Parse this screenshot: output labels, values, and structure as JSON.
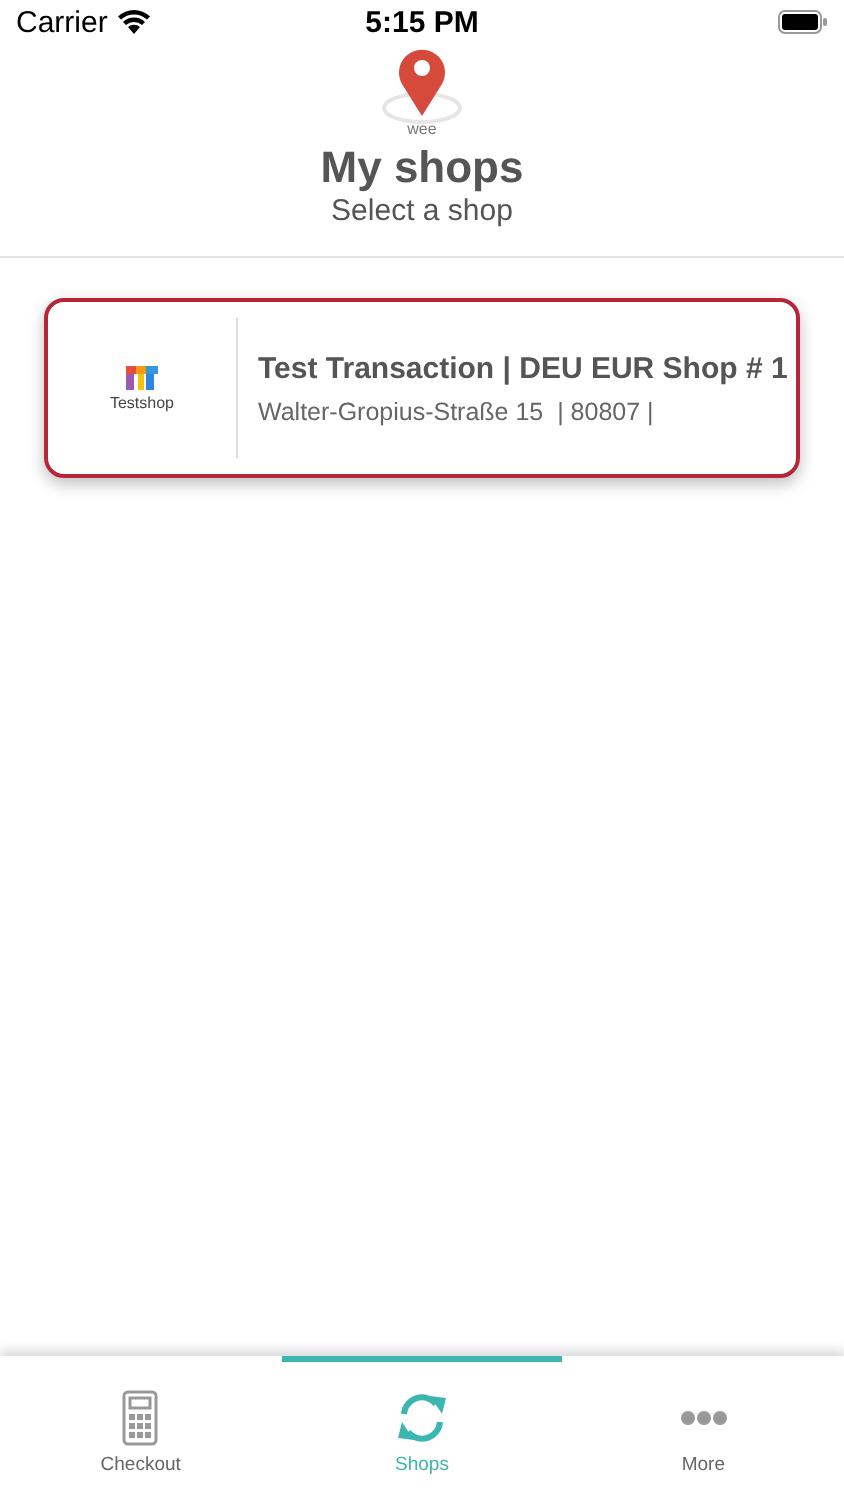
{
  "status_bar": {
    "carrier": "Carrier",
    "time": "5:15 PM"
  },
  "header": {
    "logo_text": "wee",
    "title": "My shops",
    "subtitle": "Select a shop"
  },
  "shops": [
    {
      "logo_text": "Testshop",
      "name": "Test Transaction | DEU EUR Shop # 1",
      "address": "Walter-Gropius-Straße 15  | 80807 |",
      "selected": true
    }
  ],
  "tabs": [
    {
      "label": "Checkout",
      "kind": "calculator",
      "selected": false
    },
    {
      "label": "Shops",
      "kind": "refresh",
      "selected": true
    },
    {
      "label": "More",
      "kind": "dots",
      "selected": false
    }
  ]
}
